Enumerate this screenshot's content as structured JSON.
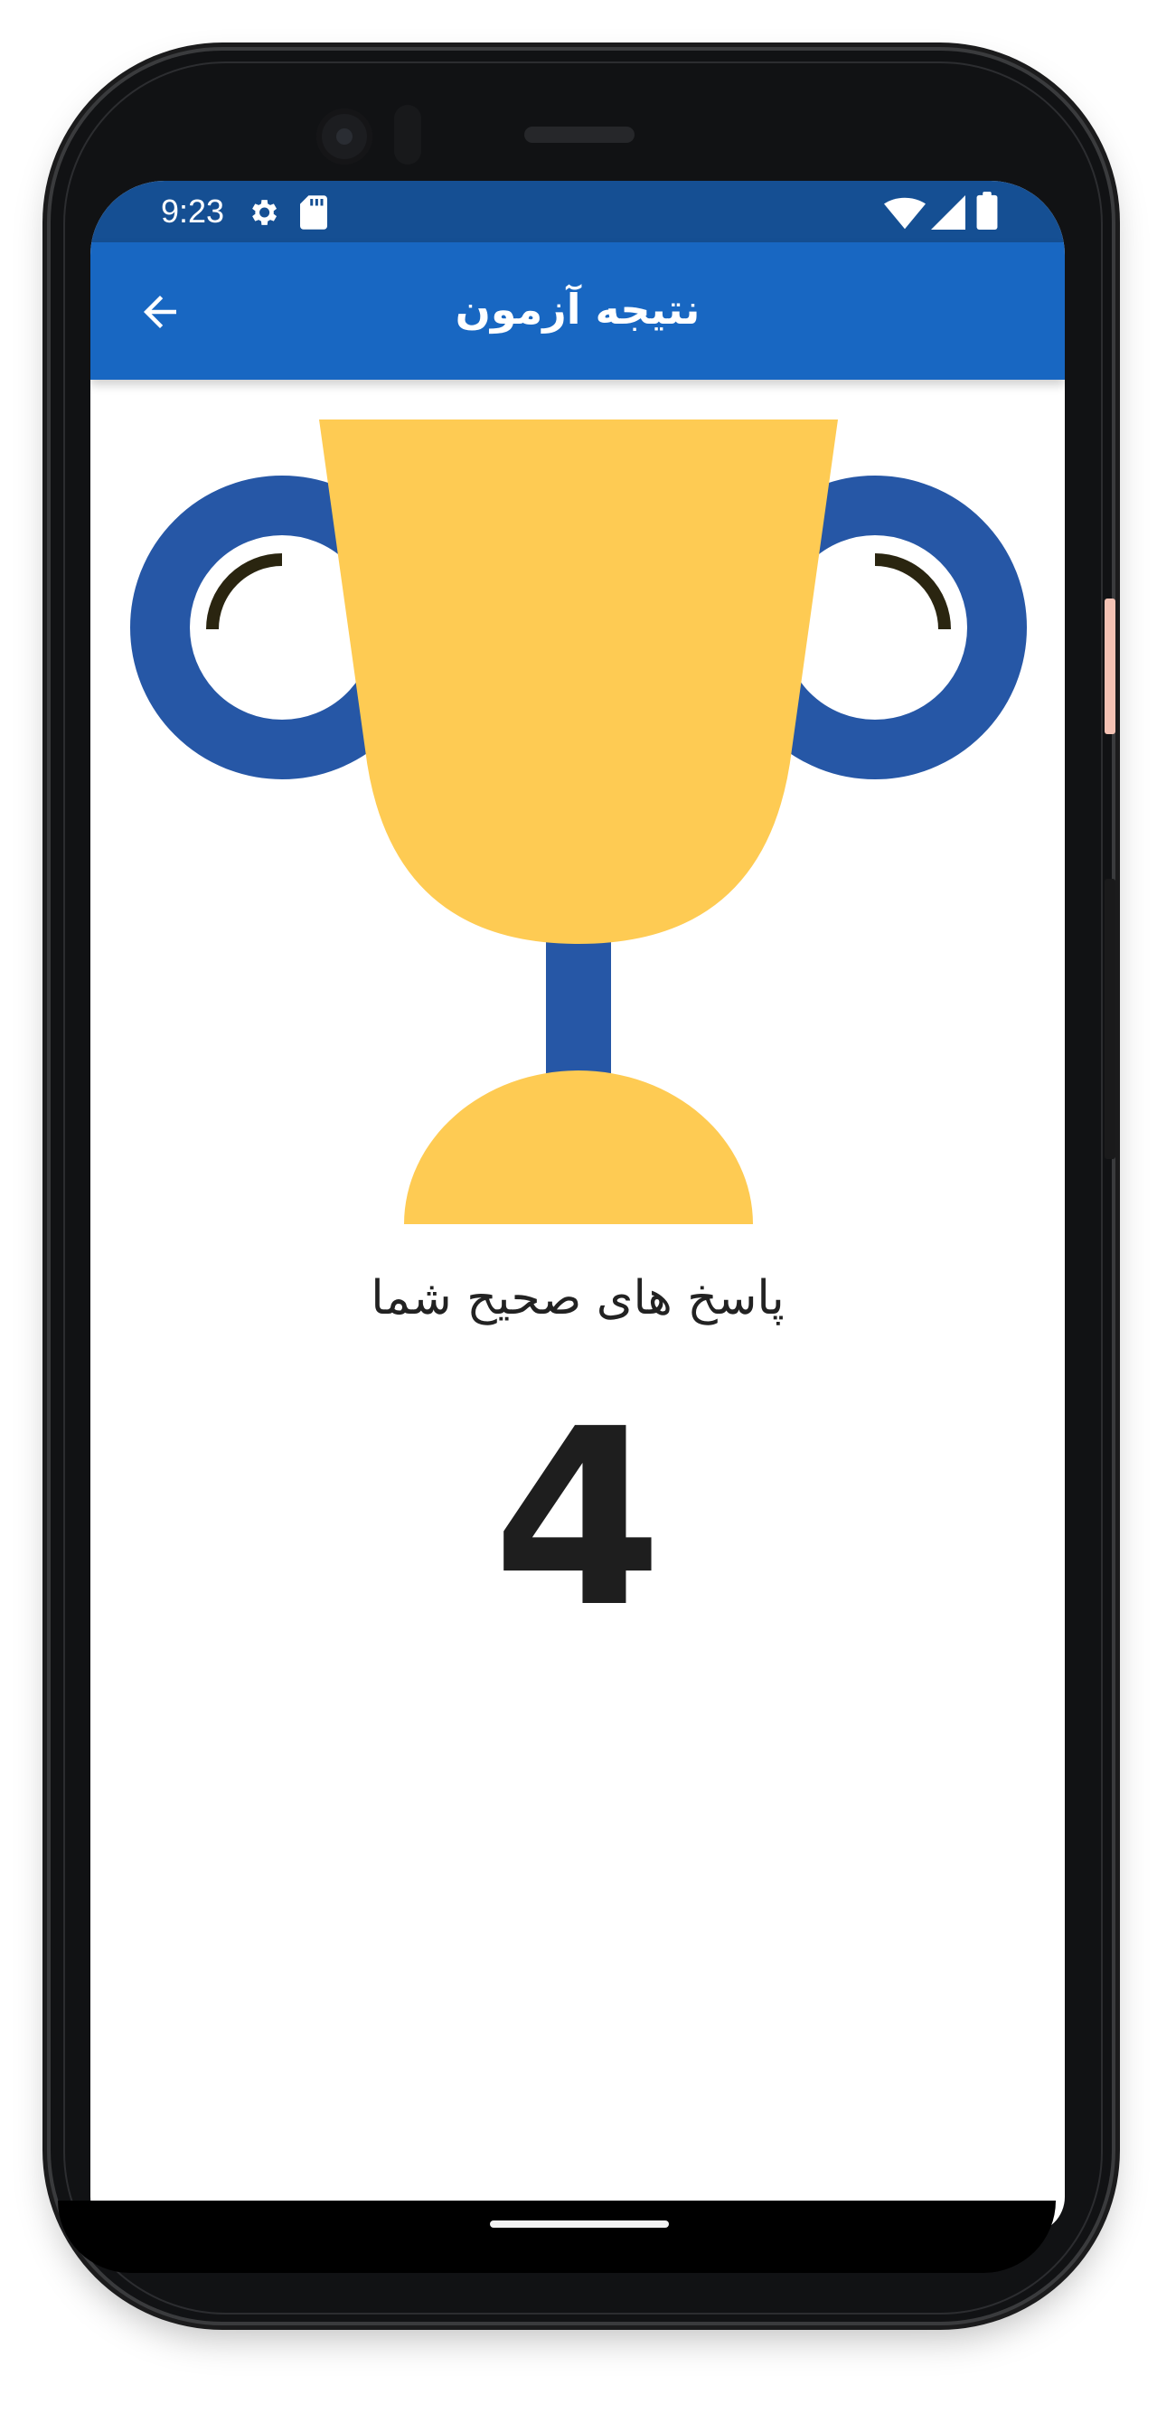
{
  "status_bar": {
    "time": "9:23",
    "left_icons": [
      "settings-icon",
      "sd-card-icon"
    ],
    "right_icons": [
      "wifi-icon",
      "signal-icon",
      "battery-icon"
    ],
    "background": "#154f93"
  },
  "app_bar": {
    "title": "نتیجه آزمون",
    "back_icon": "arrow-back-icon",
    "background": "#1867c2"
  },
  "illustration": {
    "icon": "trophy-icon",
    "cup_color": "#fecb53",
    "handle_color": "#2657a6",
    "accent_color": "#2a2510"
  },
  "result": {
    "label": "پاسخ های صحیح شما",
    "correct_count": "4"
  }
}
